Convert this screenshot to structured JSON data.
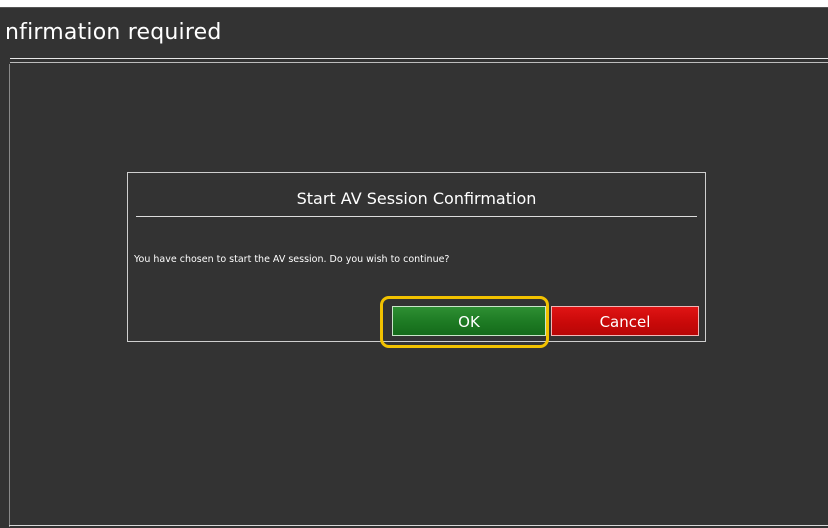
{
  "header": {
    "title": "nfirmation required"
  },
  "dialog": {
    "title": "Start AV Session Confirmation",
    "message": "You have chosen to start the AV session. Do you wish to continue?",
    "ok_label": "OK",
    "cancel_label": "Cancel"
  },
  "colors": {
    "background": "#333333",
    "ok_button": "#1d7a23",
    "cancel_button": "#c90909",
    "highlight": "#f2c200"
  }
}
